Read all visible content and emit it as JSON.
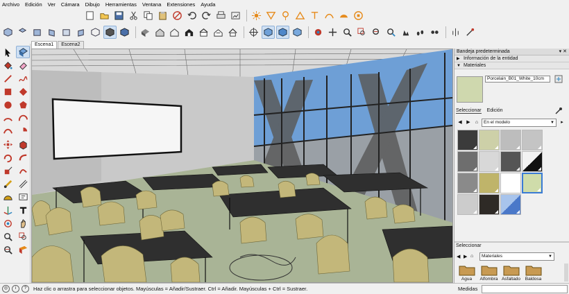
{
  "menu": [
    "Archivo",
    "Edición",
    "Ver",
    "Cámara",
    "Dibujo",
    "Herramientas",
    "Ventana",
    "Extensiones",
    "Ayuda"
  ],
  "scene_tabs": [
    "Escena1",
    "Escena2"
  ],
  "tray": {
    "title": "Bandeja predeterminada",
    "title_controls": "▾ ✕",
    "panels": [
      {
        "label": "Información de la entidad",
        "arrow": "▶"
      },
      {
        "label": "Materiales",
        "arrow": "▼"
      }
    ],
    "material_name": "Porcelain_B01_White_10cm",
    "tabs": [
      "Seleccionar",
      "Edición"
    ],
    "library_select": "En el modelo",
    "library_swatch_colors": [
      "#3b3b3b",
      "#cdd0a8",
      "#bdbdbd",
      "#c4c4c4",
      "#6e6e6e",
      "#d8d8d8",
      "#555555",
      "#1a1a1a",
      "#8a8a8a",
      "#bfb46a",
      "#ffffff",
      "#cfdcaa",
      "#cccccc",
      "#2e2a26",
      "#7b9ed8",
      ""
    ],
    "lower_title": "Seleccionar",
    "lower_select": "Materiales",
    "categories": [
      "Agua",
      "Alfombra",
      "Asfaltado",
      "Baldosa"
    ]
  },
  "status": {
    "message": "Haz clic o arrastra para seleccionar objetos. Mayúsculas = Añadir/Sustraer. Ctrl = Añadir. Mayúsculas + Ctrl = Sustraer.",
    "measure_label": "Medidas",
    "measure_value": ""
  },
  "colors": {
    "accent": "#3a7bd5",
    "toolbar_active": "#cfe0f3",
    "chair": "#c3b77a",
    "table": "#2f2f2f",
    "floor": "#a9b496"
  }
}
